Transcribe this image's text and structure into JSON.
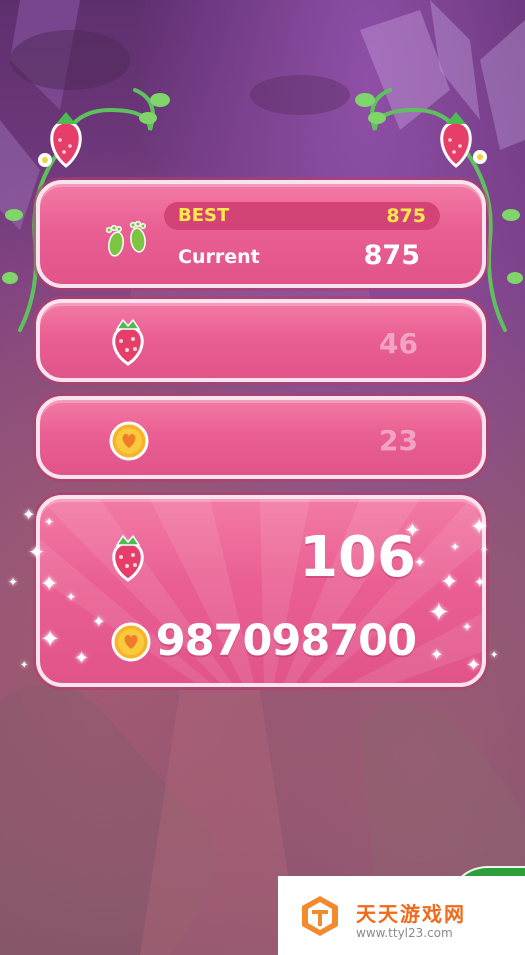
{
  "scores": {
    "best_label": "BEST",
    "best_value": "875",
    "current_label": "Current",
    "current_value": "875"
  },
  "collected": {
    "strawberries": "46",
    "coins": "23"
  },
  "totals": {
    "strawberries": "106",
    "coins": "987098700"
  },
  "watermark": {
    "title": "天天游戏网",
    "url": "www.ttyl23.com"
  },
  "icons": [
    "footprints-icon",
    "strawberry-icon",
    "heart-coin-icon",
    "vine-decoration",
    "sparkle-icon"
  ],
  "colors": {
    "panel": "#ea5f93",
    "best_text": "#ffe94a",
    "background": "#7a3f84"
  }
}
